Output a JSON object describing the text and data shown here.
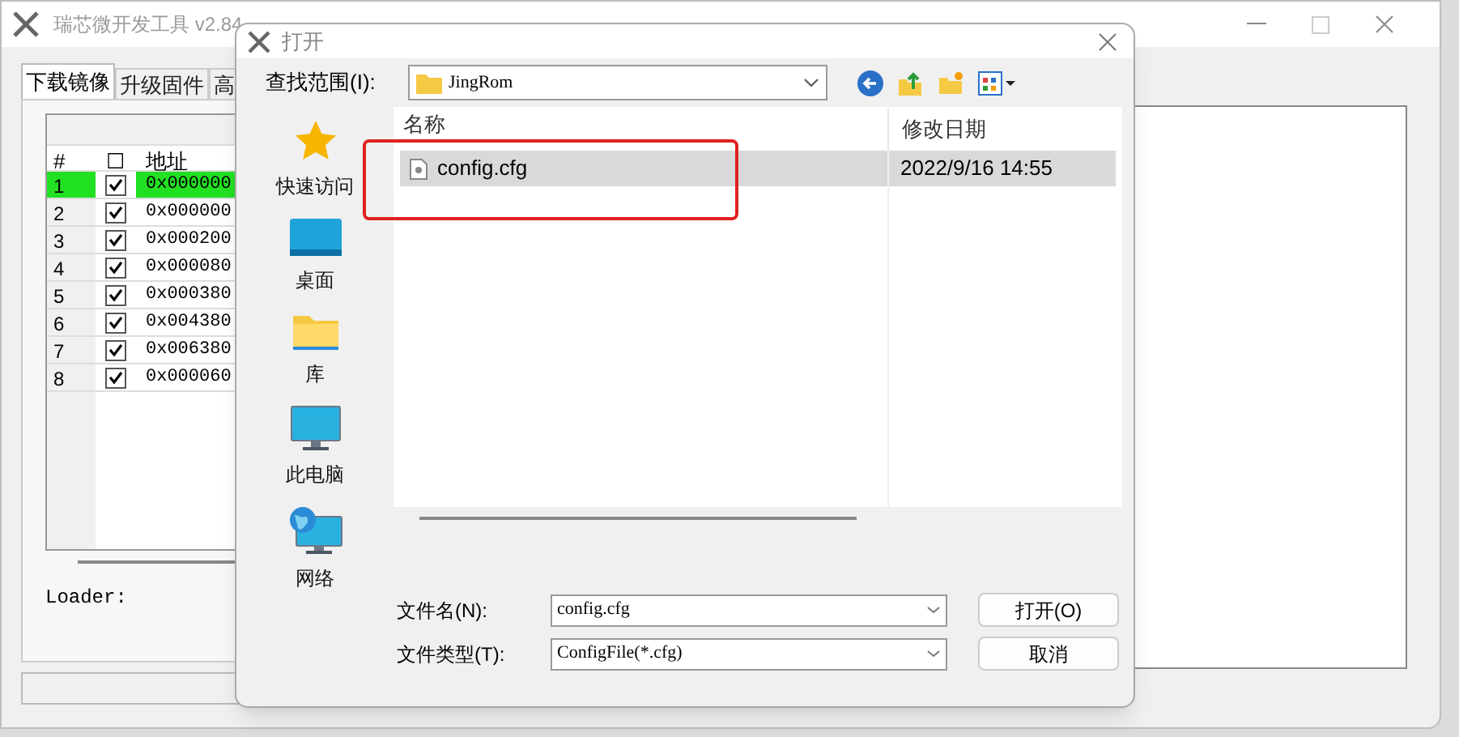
{
  "window": {
    "title": "瑞芯微开发工具 v2.84"
  },
  "tabs": [
    {
      "label": "下载镜像",
      "selected": true
    },
    {
      "label": "升级固件",
      "selected": false
    },
    {
      "label": "高",
      "selected": false
    }
  ],
  "table": {
    "columns": [
      "#",
      "☐",
      "地址"
    ],
    "rows": [
      {
        "index": "1",
        "checked": true,
        "address": "0x000000",
        "selected": true
      },
      {
        "index": "2",
        "checked": true,
        "address": "0x000000",
        "selected": false
      },
      {
        "index": "3",
        "checked": true,
        "address": "0x000200",
        "selected": false
      },
      {
        "index": "4",
        "checked": true,
        "address": "0x000080",
        "selected": false
      },
      {
        "index": "5",
        "checked": true,
        "address": "0x000380",
        "selected": false
      },
      {
        "index": "6",
        "checked": true,
        "address": "0x004380",
        "selected": false
      },
      {
        "index": "7",
        "checked": true,
        "address": "0x006380",
        "selected": false
      },
      {
        "index": "8",
        "checked": true,
        "address": "0x000060",
        "selected": false
      }
    ]
  },
  "loader_label": "Loader:",
  "dialog": {
    "title": "打开",
    "look_in_label": "查找范围(I):",
    "look_in_value": "JingRom",
    "places": [
      {
        "label": "快速访问",
        "kind": "star"
      },
      {
        "label": "桌面",
        "kind": "desktop"
      },
      {
        "label": "库",
        "kind": "folder"
      },
      {
        "label": "此电脑",
        "kind": "monitor"
      },
      {
        "label": "网络",
        "kind": "network"
      }
    ],
    "columns": [
      "名称",
      "修改日期"
    ],
    "files": [
      {
        "name": "config.cfg",
        "modified": "2022/9/16 14:55",
        "selected": true
      }
    ],
    "file_name_label": "文件名(N):",
    "file_name_value": "config.cfg",
    "file_type_label": "文件类型(T):",
    "file_type_value": "ConfigFile(*.cfg)",
    "buttons": [
      "打开(O)",
      "取消"
    ]
  }
}
